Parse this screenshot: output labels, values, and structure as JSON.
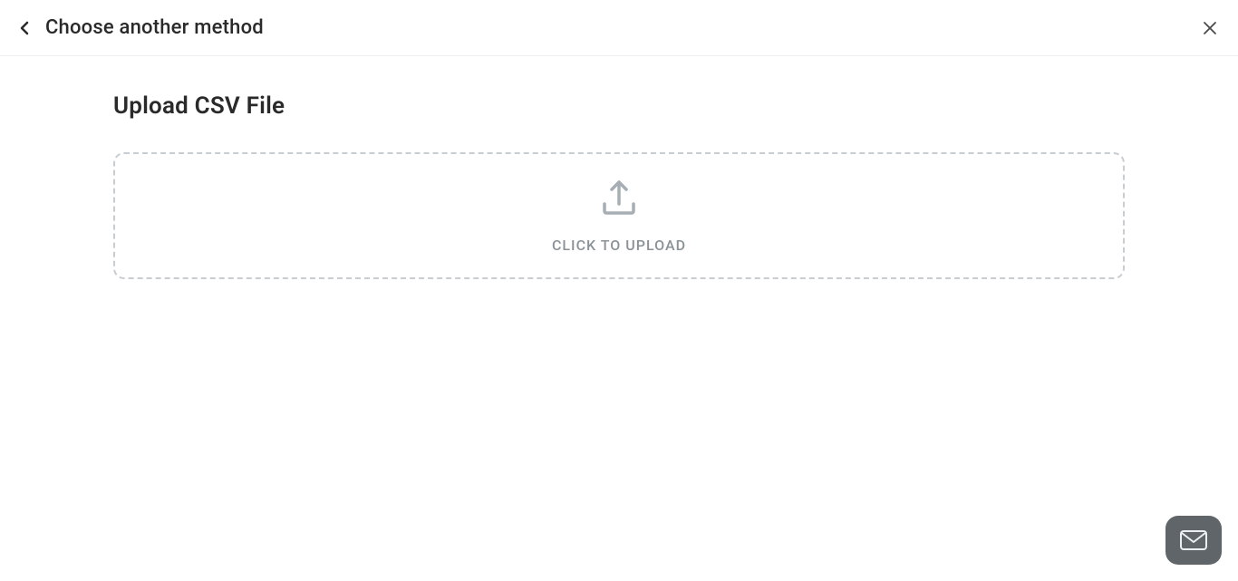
{
  "header": {
    "back_label": "Choose another method"
  },
  "page": {
    "title": "Upload CSV File",
    "upload_prompt": "CLICK TO UPLOAD"
  }
}
